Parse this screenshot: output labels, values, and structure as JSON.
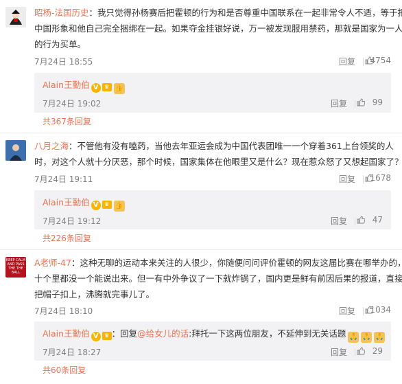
{
  "comments": [
    {
      "username": "昭杨-法国历史",
      "lines": [
        "：我只觉得孙杨赛后把霍顿的行为和是否尊重中国联系在一起非常令人不适，等于把",
        "中国形象和他自己完全捆绑在一起。如果夺金挂银好说，万一被发现服用禁药，那就是国家为一人",
        "的行为买单。"
      ],
      "time": "7月24日 18:55",
      "reply_label": "回复",
      "like_count": "4754",
      "nested": {
        "author": "Alain王勤伯",
        "text": "",
        "time": "7月24日 19:02",
        "reply_label": "回复",
        "like_count": "99"
      },
      "total_replies": "共367条回复"
    },
    {
      "username": "八月之海",
      "lines": [
        "：不管他有没有嗑药，当他去年亚运会成为中国代表团唯一一个穿着361上台领奖的人",
        "时，对这个人就十分厌恶，那个时候，国家集体在他眼里又是什么？现在惹众怒了又想起国家了？"
      ],
      "time": "7月24日 19:11",
      "reply_label": "回复",
      "like_count": "1678",
      "nested": {
        "author": "Alain王勤伯",
        "text": "",
        "time": "7月24日 19:12",
        "reply_label": "回复",
        "like_count": "47"
      },
      "total_replies": "共226条回复"
    },
    {
      "username": "A老师-47",
      "lines": [
        "：这种无聊的运动本来关注的人很少，你随便问问评价霍顿的网友这届比赛在哪举办的，",
        "十个里都没一个能说出来。但一有中外争议了一下就炸锅了，国内更是鲜有前因后果的报道，直接",
        "把帽子扣上，沸腾就完事儿了。"
      ],
      "time": "7月24日 18:10",
      "reply_label": "回复",
      "like_count": "1034",
      "nested": {
        "author": "Alain王勤伯",
        "reply_prefix": "：回复",
        "mention": "@给女儿的话",
        "text": ":拜托一下这两位朋友，不延伸到无关话题",
        "time": "7月24日 18:27",
        "reply_label": "回复",
        "like_count": "29"
      },
      "total_replies": "共60条回复"
    }
  ],
  "avatar3_text": "KEEP CALM AND PASS THE THE BALL",
  "icons": {
    "verified": "verified-v-badge-icon",
    "level": "member-level-icon",
    "thumb": "thumbs-up-icon",
    "emoji": "thumbs-up-emoji-icon"
  },
  "colors": {
    "accent": "#eb7350",
    "meta": "#808080",
    "nested_bg": "#f2f2f5"
  }
}
